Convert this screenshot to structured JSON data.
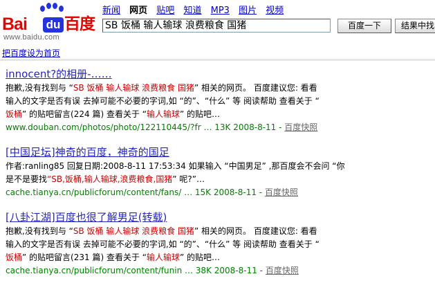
{
  "logo": {
    "brand_latin_1": "Bai",
    "brand_latin_2": "du",
    "brand_cn": "百度",
    "url": "www.baidu.com"
  },
  "nav": {
    "items": [
      "新闻",
      "网页",
      "贴吧",
      "知道",
      "MP3",
      "图片",
      "视频"
    ],
    "active_index": 1
  },
  "search": {
    "query": "SB 饭桶  输人输球  浪费粮食  国猪",
    "search_button": "百度一下",
    "within_button": "结果中找"
  },
  "set_home": "把百度设为首页",
  "results": [
    {
      "title": "innocent?的相册-……",
      "body": [
        [
          [
            "t",
            "抱歉,没有找到与 “"
          ],
          [
            "h",
            "SB 饭桶  输人输球  浪费粮食  国猪"
          ],
          [
            "t",
            "”  相关的网页。 百度建议您: 看看"
          ]
        ],
        [
          [
            "t",
            "输入的文字是否有误  去掉可能不必要的字词,如 “的”、“什么” 等  阅读帮助  查看关于 “"
          ]
        ],
        [
          [
            "h",
            "饭桶"
          ],
          [
            "t",
            "” 的贴吧留言(224 篇) 查看关于 “"
          ],
          [
            "h",
            "输人输球"
          ],
          [
            "t",
            "” 的贴吧…"
          ]
        ]
      ],
      "url": "www.douban.com/photos/photo/122110445/?fr … 13K 2008-8-11 - ",
      "cache": "百度快照"
    },
    {
      "title": "[中国足坛]神奇的百度，神奇的国足",
      "body": [
        [
          [
            "t",
            "作者:ranling85 回复日期:2008-8-11 17:53:34 如果输入 “中国男足” ,那百度会不会问 “你"
          ]
        ],
        [
          [
            "t",
            "是不是要找"
          ],
          [
            "h",
            "“SB,饭桶,输人输球,浪费粮食,国猪"
          ],
          [
            "t",
            "” 呢?”…"
          ]
        ]
      ],
      "url": "cache.tianya.cn/publicforum/content/fans/ … 15K 2008-8-11 - ",
      "cache": "百度快照"
    },
    {
      "title": "[八卦江湖]百度也很了解男足(转载)",
      "body": [
        [
          [
            "t",
            "抱歉,没有找到与 “"
          ],
          [
            "h",
            "SB 饭桶  输人输球  浪费粮食  国猪"
          ],
          [
            "t",
            "”  相关的网页。 百度建议您: 看看"
          ]
        ],
        [
          [
            "t",
            "输入的文字是否有误  去掉可能不必要的字词,如 “的”、“什么” 等  阅读帮助  查看关于 “"
          ]
        ],
        [
          [
            "h",
            "饭桶"
          ],
          [
            "t",
            "” 的贴吧留言(231 篇) 查看关于 “"
          ],
          [
            "h",
            "输人输球"
          ],
          [
            "t",
            "” 的贴吧…"
          ]
        ]
      ],
      "url": "cache.tianya.cn/publicforum/content/funin … 38K 2008-8-11 - ",
      "cache": "百度快照"
    }
  ],
  "colors": {
    "link": "#2424c4",
    "highlight": "#cc0000",
    "url_green": "#008000",
    "logo_red": "#e10602",
    "logo_blue": "#2432e0"
  }
}
